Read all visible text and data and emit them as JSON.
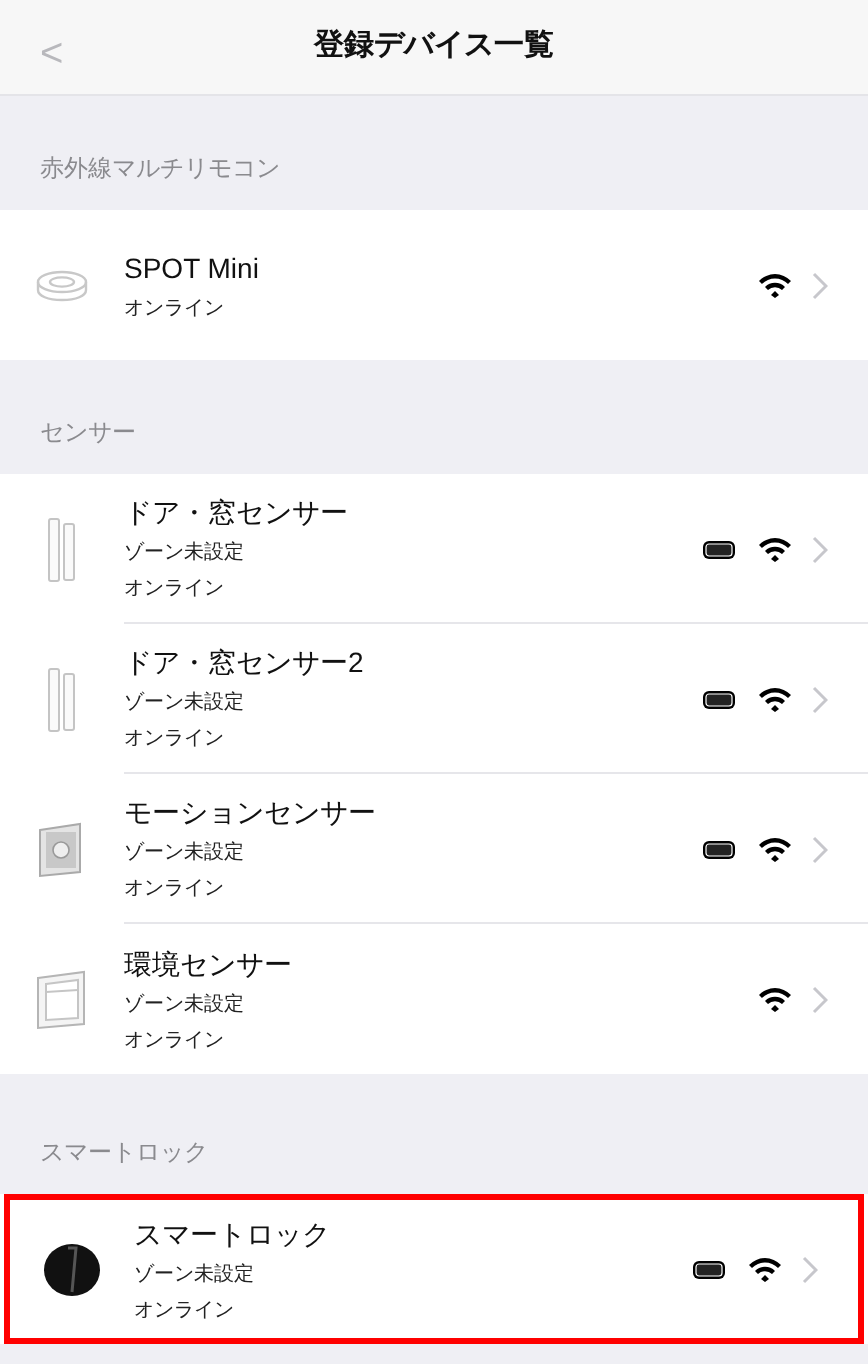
{
  "header": {
    "back": "<",
    "title": "登録デバイス一覧"
  },
  "sections": [
    {
      "label": "赤外線マルチリモコン",
      "devices": [
        {
          "kind": "puck",
          "name": "SPOT Mini",
          "status": "オンライン",
          "battery": false,
          "wifi": true,
          "highlighted": false
        }
      ]
    },
    {
      "label": "センサー",
      "devices": [
        {
          "kind": "door",
          "name": "ドア・窓センサー",
          "zone": "ゾーン未設定",
          "status": "オンライン",
          "battery": true,
          "wifi": true,
          "highlighted": false
        },
        {
          "kind": "door",
          "name": "ドア・窓センサー2",
          "zone": "ゾーン未設定",
          "status": "オンライン",
          "battery": true,
          "wifi": true,
          "highlighted": false
        },
        {
          "kind": "motion",
          "name": "モーションセンサー",
          "zone": "ゾーン未設定",
          "status": "オンライン",
          "battery": true,
          "wifi": true,
          "highlighted": false
        },
        {
          "kind": "environment",
          "name": "環境センサー",
          "zone": "ゾーン未設定",
          "status": "オンライン",
          "battery": false,
          "wifi": true,
          "highlighted": false
        }
      ]
    },
    {
      "label": "スマートロック",
      "devices": [
        {
          "kind": "lock",
          "name": "スマートロック",
          "zone": "ゾーン未設定",
          "status": "オンライン",
          "battery": true,
          "wifi": true,
          "highlighted": true
        }
      ]
    }
  ]
}
